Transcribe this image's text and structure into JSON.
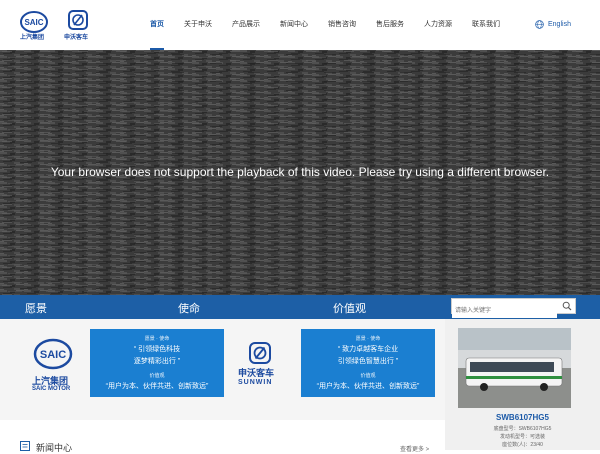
{
  "header": {
    "saic_logo_text": "上汽集团",
    "sunwin_logo_text": "申沃客车",
    "nav": [
      "首页",
      "关于申沃",
      "产品展示",
      "新闻中心",
      "销售咨询",
      "售后服务",
      "人力资源",
      "联系我们"
    ],
    "active_index": 0,
    "language": "English"
  },
  "video": {
    "message": "Your browser does not support the playback of this video. Please try using a different browser."
  },
  "bluebar": {
    "vision": "愿景",
    "mission": "使命",
    "values": "价值观"
  },
  "search": {
    "placeholder": "请输入关键字"
  },
  "brand": {
    "saic_cn": "上汽集团",
    "saic_en": "SAIC MOTOR",
    "sunwin_cn": "申沃客车",
    "sunwin_en": "SUNWIN",
    "panel1": {
      "heading": "愿景 · 使命",
      "line1": "“ 引领绿色科技",
      "line2": "逐梦精彩出行 ”",
      "value_label": "价值观",
      "value_line": "“用户为本、伙伴共进、创新致远”"
    },
    "panel2": {
      "heading": "愿景 · 使命",
      "line1": "“ 致力卓越客车企业",
      "line2": "引领绿色智慧出行 ”",
      "value_label": "价值观",
      "value_line": "“用户为本、伙伴共进、创新致远”"
    }
  },
  "product": {
    "name": "SWB6107HG5",
    "specs": [
      "底盘型号：SWB6107HG5",
      "发动机型号：可选装",
      "座位数(人)：23/40"
    ]
  },
  "news": {
    "title": "新闻中心",
    "more": "查看更多 >"
  },
  "colors": {
    "brand_blue": "#1d5fa6",
    "panel_blue": "#1b7fd1"
  }
}
